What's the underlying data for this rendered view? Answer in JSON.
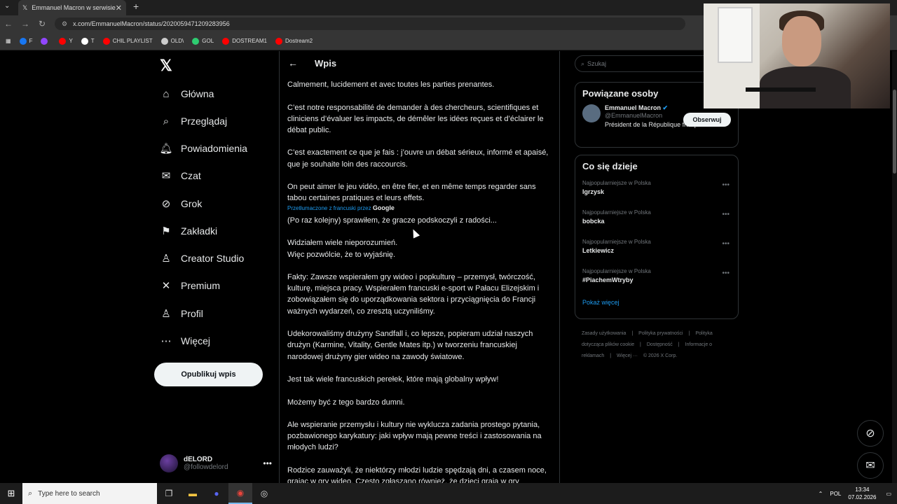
{
  "browser": {
    "tab_title": "Emmanuel Macron w serwisie X",
    "url": "x.com/EmmanuelMacron/status/2020059471209283956",
    "bookmarks": [
      {
        "label": "F",
        "color": "#1877f2"
      },
      {
        "label": "",
        "color": "#9146ff"
      },
      {
        "label": "Y",
        "color": "#ff0000"
      },
      {
        "label": "T",
        "color": "#ffffff"
      },
      {
        "label": "CHIL PLAYLIST",
        "color": "#ff0000"
      },
      {
        "label": "OLD\\",
        "color": "#cccccc"
      },
      {
        "label": "GOL",
        "color": "#2ecc71"
      },
      {
        "label": "DOSTREAM1",
        "color": "#ff0000"
      },
      {
        "label": "Dostream2",
        "color": "#ff0000"
      }
    ]
  },
  "nav": {
    "items": [
      {
        "label": "Główna",
        "icon": "home-icon",
        "glyph": "⌂"
      },
      {
        "label": "Przeglądaj",
        "icon": "search-icon",
        "glyph": "⌕"
      },
      {
        "label": "Powiadomienia",
        "icon": "bell-icon",
        "glyph": "🔔︎"
      },
      {
        "label": "Czat",
        "icon": "mail-icon",
        "glyph": "✉"
      },
      {
        "label": "Grok",
        "icon": "grok-icon",
        "glyph": "⊘"
      },
      {
        "label": "Zakładki",
        "icon": "bookmark-icon",
        "glyph": "⚑"
      },
      {
        "label": "Creator Studio",
        "icon": "creator-icon",
        "glyph": "♙"
      },
      {
        "label": "Premium",
        "icon": "x-icon",
        "glyph": "✕"
      },
      {
        "label": "Profil",
        "icon": "profile-icon",
        "glyph": "♙"
      },
      {
        "label": "Więcej",
        "icon": "more-icon",
        "glyph": "⋯"
      }
    ],
    "publish_label": "Opublikuj wpis",
    "user_name": "dELORD",
    "user_handle": "@followdelord"
  },
  "main": {
    "title": "Wpis",
    "paragraphs": [
      "Calmement, lucidement et avec toutes les parties prenantes.",
      "C’est notre responsabilité de demander à des chercheurs, scientifiques et cliniciens d’évaluer les impacts, de démêler les idées reçues et d’éclairer le débat public.",
      "C’est exactement ce que je fais : j’ouvre un débat sérieux, informé et apaisé, que je souhaite loin des raccourcis.",
      "On peut aimer le jeu vidéo, en être fier, et en même temps regarder sans tabou certaines pratiques et leurs effets."
    ],
    "translated_label": "Przetłumaczone z francuski przez",
    "translated_brand": "Google",
    "translation": [
      "(Po raz kolejny) sprawiłem, że gracze podskoczyli z radości...",
      "Widziałem wiele nieporozumień.\nWięc pozwólcie, że to wyjaśnię.",
      "Fakty: Zawsze wspierałem gry wideo i popkulturę – przemysł, twórczość, kulturę, miejsca pracy. Wspierałem francuski e-sport w Pałacu Elizejskim i zobowiązałem się do uporządkowania sektora i przyciągnięcia do Francji ważnych wydarzeń, co zresztą uczyniliśmy.",
      "Udekorowaliśmy drużyny Sandfall i, co lepsze, popieram udział naszych drużyn (Karmine, Vitality, Gentle Mates itp.) w tworzeniu francuskiej narodowej drużyny gier wideo na zawody światowe.",
      "Jest tak wiele francuskich perełek, które mają globalny wpływ!",
      "Możemy być z tego bardzo dumni.",
      "Ale wspieranie przemysłu i kultury nie wyklucza zadania prostego pytania, pozbawionego karykatury: jaki wpływ mają pewne treści i zastosowania na młodych ludzi?",
      "Rodzice zauważyli, że niektórzy młodzi ludzie spędzają dni, a czasem noce, grając w gry wideo. Często zgłaszano również, że dzieci grają w gry"
    ]
  },
  "sidebar": {
    "search_placeholder": "Szukaj",
    "related_title": "Powiązane osoby",
    "person_name": "Emmanuel Macron",
    "person_handle": "@EmmanuelMacron",
    "person_bio": "Président de la République française.",
    "follow_label": "Obserwuj",
    "trends_title": "Co się dzieje",
    "trends": [
      {
        "context": "Najpopularniejsze w Polska",
        "topic": "Igrzysk"
      },
      {
        "context": "Najpopularniejsze w Polska",
        "topic": "bobcka"
      },
      {
        "context": "Najpopularniejsze w Polska",
        "topic": "Letkiewicz"
      },
      {
        "context": "Najpopularniejsze w Polska",
        "topic": "#PiachemWtryby"
      }
    ],
    "show_more": "Pokaż więcej",
    "footer": [
      "Zasady użytkowania",
      "|",
      "Polityka prywatności",
      "|",
      "Polityka dotycząca plików cookie",
      "|",
      "Dostępność",
      "|",
      "Informacje o reklamach",
      "|",
      "Więcej ···",
      "© 2026 X Corp."
    ]
  },
  "taskbar": {
    "search_placeholder": "Type here to search",
    "lang": "POL",
    "time": "13:34",
    "date": "07.02.2026"
  }
}
